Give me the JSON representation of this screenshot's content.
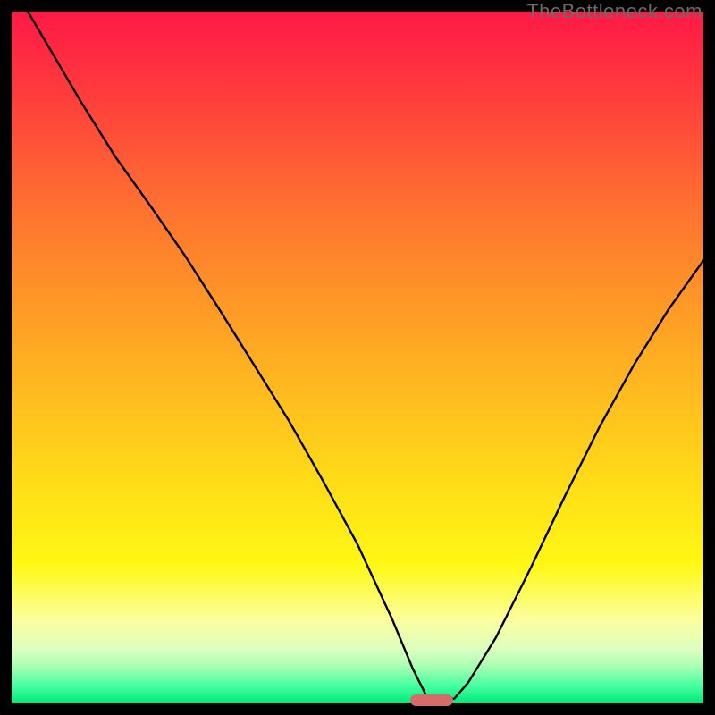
{
  "watermark": "TheBottleneck.com",
  "marker": {
    "x_frac": 0.607,
    "width_frac": 0.062,
    "color": "#d86a6a"
  },
  "chart_data": {
    "type": "line",
    "title": "",
    "xlabel": "",
    "ylabel": "",
    "xlim": [
      0,
      1
    ],
    "ylim": [
      0,
      1
    ],
    "series": [
      {
        "name": "bottleneck-curve",
        "x": [
          0.0,
          0.05,
          0.1,
          0.15,
          0.2,
          0.25,
          0.3,
          0.35,
          0.4,
          0.45,
          0.5,
          0.55,
          0.58,
          0.605,
          0.64,
          0.66,
          0.7,
          0.75,
          0.8,
          0.85,
          0.9,
          0.95,
          1.0
        ],
        "y": [
          1.04,
          0.955,
          0.87,
          0.79,
          0.72,
          0.648,
          0.57,
          0.49,
          0.41,
          0.322,
          0.23,
          0.122,
          0.05,
          0.0,
          0.007,
          0.03,
          0.095,
          0.195,
          0.3,
          0.4,
          0.49,
          0.57,
          0.64
        ]
      }
    ],
    "gradient_stops": [
      {
        "pos": 0.0,
        "color": "#ff1946"
      },
      {
        "pos": 0.12,
        "color": "#ff3c3c"
      },
      {
        "pos": 0.26,
        "color": "#ff6a32"
      },
      {
        "pos": 0.4,
        "color": "#ff9228"
      },
      {
        "pos": 0.54,
        "color": "#ffb820"
      },
      {
        "pos": 0.68,
        "color": "#ffdc18"
      },
      {
        "pos": 0.8,
        "color": "#fff814"
      },
      {
        "pos": 0.88,
        "color": "#fcffa0"
      },
      {
        "pos": 0.925,
        "color": "#d8ffc0"
      },
      {
        "pos": 0.95,
        "color": "#9effb0"
      },
      {
        "pos": 0.975,
        "color": "#44ffa0"
      },
      {
        "pos": 1.0,
        "color": "#00e878"
      }
    ]
  }
}
